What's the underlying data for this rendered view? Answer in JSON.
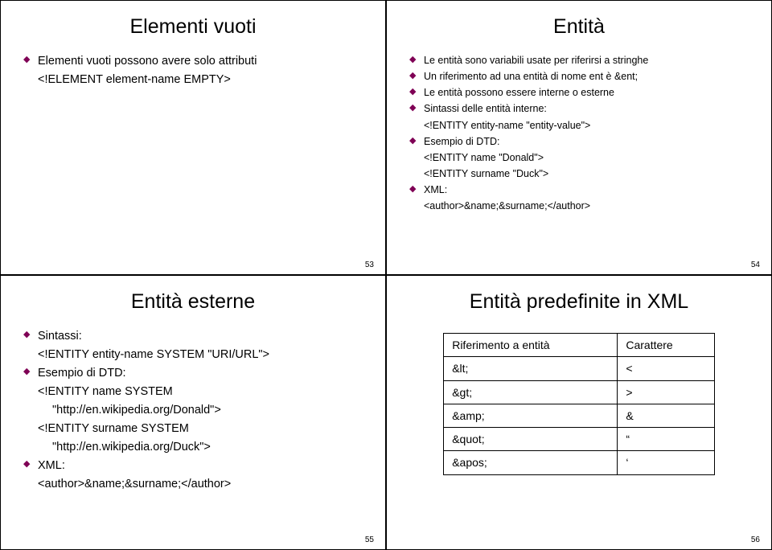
{
  "slides": [
    {
      "title": "Elementi vuoti",
      "b1": "Elementi vuoti possono avere solo attributi",
      "l1": "<!ELEMENT element-name EMPTY>",
      "pg": "53"
    },
    {
      "title": "Entità",
      "b1": "Le entità sono variabili usate per riferirsi a stringhe",
      "b2": "Un riferimento ad una entità di nome ent è &ent;",
      "b3": "Le entità possono essere interne o esterne",
      "b4": "Sintassi delle entità interne:",
      "l4": "<!ENTITY entity-name \"entity-value\">",
      "b5": "Esempio di DTD:",
      "l5a": "<!ENTITY name \"Donald\">",
      "l5b": "<!ENTITY surname \"Duck\">",
      "b6": "XML:",
      "l6": "<author>&name;&surname;</author>",
      "pg": "54"
    },
    {
      "title": "Entità esterne",
      "b1": "Sintassi:",
      "l1": "<!ENTITY entity-name SYSTEM \"URI/URL\">",
      "b2": "Esempio di DTD:",
      "l2a_a": "<!ENTITY name SYSTEM",
      "l2a_b": "\"http://en.wikipedia.org/Donald\">",
      "l2b_a": "<!ENTITY surname SYSTEM",
      "l2b_b": "\"http://en.wikipedia.org/Duck\">",
      "b3": "XML:",
      "l3": "<author>&name;&surname;</author>",
      "pg": "55"
    },
    {
      "title": "Entità predefinite in XML",
      "hdr1": "Riferimento a entità",
      "hdr2": "Carattere",
      "r1a": "&lt;",
      "r1b": "<",
      "r2a": "&gt;",
      "r2b": ">",
      "r3a": "&amp;",
      "r3b": "&",
      "r4a": "&quot;",
      "r4b": "“",
      "r5a": "&apos;",
      "r5b": "‘",
      "pg": "56"
    }
  ]
}
